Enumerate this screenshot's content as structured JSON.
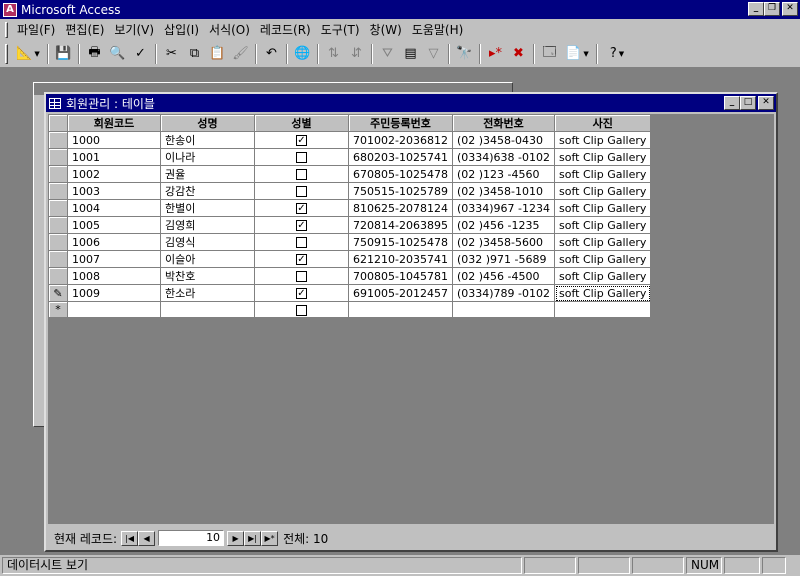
{
  "window": {
    "title": "Microsoft Access",
    "minimize": "_",
    "restore": "❐",
    "close": "✕"
  },
  "menu": [
    "파일(F)",
    "편집(E)",
    "보기(V)",
    "삽입(I)",
    "서식(O)",
    "레코드(R)",
    "도구(T)",
    "창(W)",
    "도움말(H)"
  ],
  "toolbar": {
    "icons": [
      "design-view-icon",
      "save-icon",
      "print-icon",
      "print-preview-icon",
      "spelling-icon",
      "cut-icon",
      "copy-icon",
      "paste-icon",
      "format-painter-icon",
      "undo-icon",
      "hyperlink-icon",
      "sort-ascending-icon",
      "sort-descending-icon",
      "filter-by-selection-icon",
      "filter-by-form-icon",
      "apply-filter-icon",
      "find-icon",
      "new-record-icon",
      "delete-record-icon",
      "database-window-icon",
      "new-object-icon",
      "help-icon"
    ]
  },
  "datasheet": {
    "title": "회원관리 : 테이블",
    "columns": [
      "회원코드",
      "성명",
      "성별",
      "주민등록번호",
      "전화번호",
      "사진"
    ],
    "rows": [
      {
        "code": "1000",
        "name": "한송이",
        "gender": true,
        "ssn": "701002-2036812",
        "phone": "(02  )3458-0430",
        "photo": "soft Clip Gallery"
      },
      {
        "code": "1001",
        "name": "이나라",
        "gender": false,
        "ssn": "680203-1025741",
        "phone": "(0334)638 -0102",
        "photo": "soft Clip Gallery"
      },
      {
        "code": "1002",
        "name": "권율",
        "gender": false,
        "ssn": "670805-1025478",
        "phone": "(02  )123 -4560",
        "photo": "soft Clip Gallery"
      },
      {
        "code": "1003",
        "name": "강감찬",
        "gender": false,
        "ssn": "750515-1025789",
        "phone": "(02  )3458-1010",
        "photo": "soft Clip Gallery"
      },
      {
        "code": "1004",
        "name": "한별이",
        "gender": true,
        "ssn": "810625-2078124",
        "phone": "(0334)967 -1234",
        "photo": "soft Clip Gallery"
      },
      {
        "code": "1005",
        "name": "김영희",
        "gender": true,
        "ssn": "720814-2063895",
        "phone": "(02  )456 -1235",
        "photo": "soft Clip Gallery"
      },
      {
        "code": "1006",
        "name": "김영식",
        "gender": false,
        "ssn": "750915-1025478",
        "phone": "(02  )3458-5600",
        "photo": "soft Clip Gallery"
      },
      {
        "code": "1007",
        "name": "이슬아",
        "gender": true,
        "ssn": "621210-2035741",
        "phone": "(032 )971 -5689",
        "photo": "soft Clip Gallery"
      },
      {
        "code": "1008",
        "name": "박찬호",
        "gender": false,
        "ssn": "700805-1045781",
        "phone": "(02  )456 -4500",
        "photo": "soft Clip Gallery"
      },
      {
        "code": "1009",
        "name": "한소라",
        "gender": true,
        "ssn": "691005-2012457",
        "phone": "(0334)789 -0102",
        "photo": "soft Clip Gallery"
      }
    ],
    "edit_marker": "✎",
    "new_marker": "*"
  },
  "navigation": {
    "label": "현재 레코드:",
    "current": "10",
    "total_label": "전체: 10",
    "first": "|◀",
    "prev": "◀",
    "next": "▶",
    "last": "▶|",
    "new": "▶*"
  },
  "status": {
    "text": "데이터시트 보기",
    "num": "NUM"
  }
}
